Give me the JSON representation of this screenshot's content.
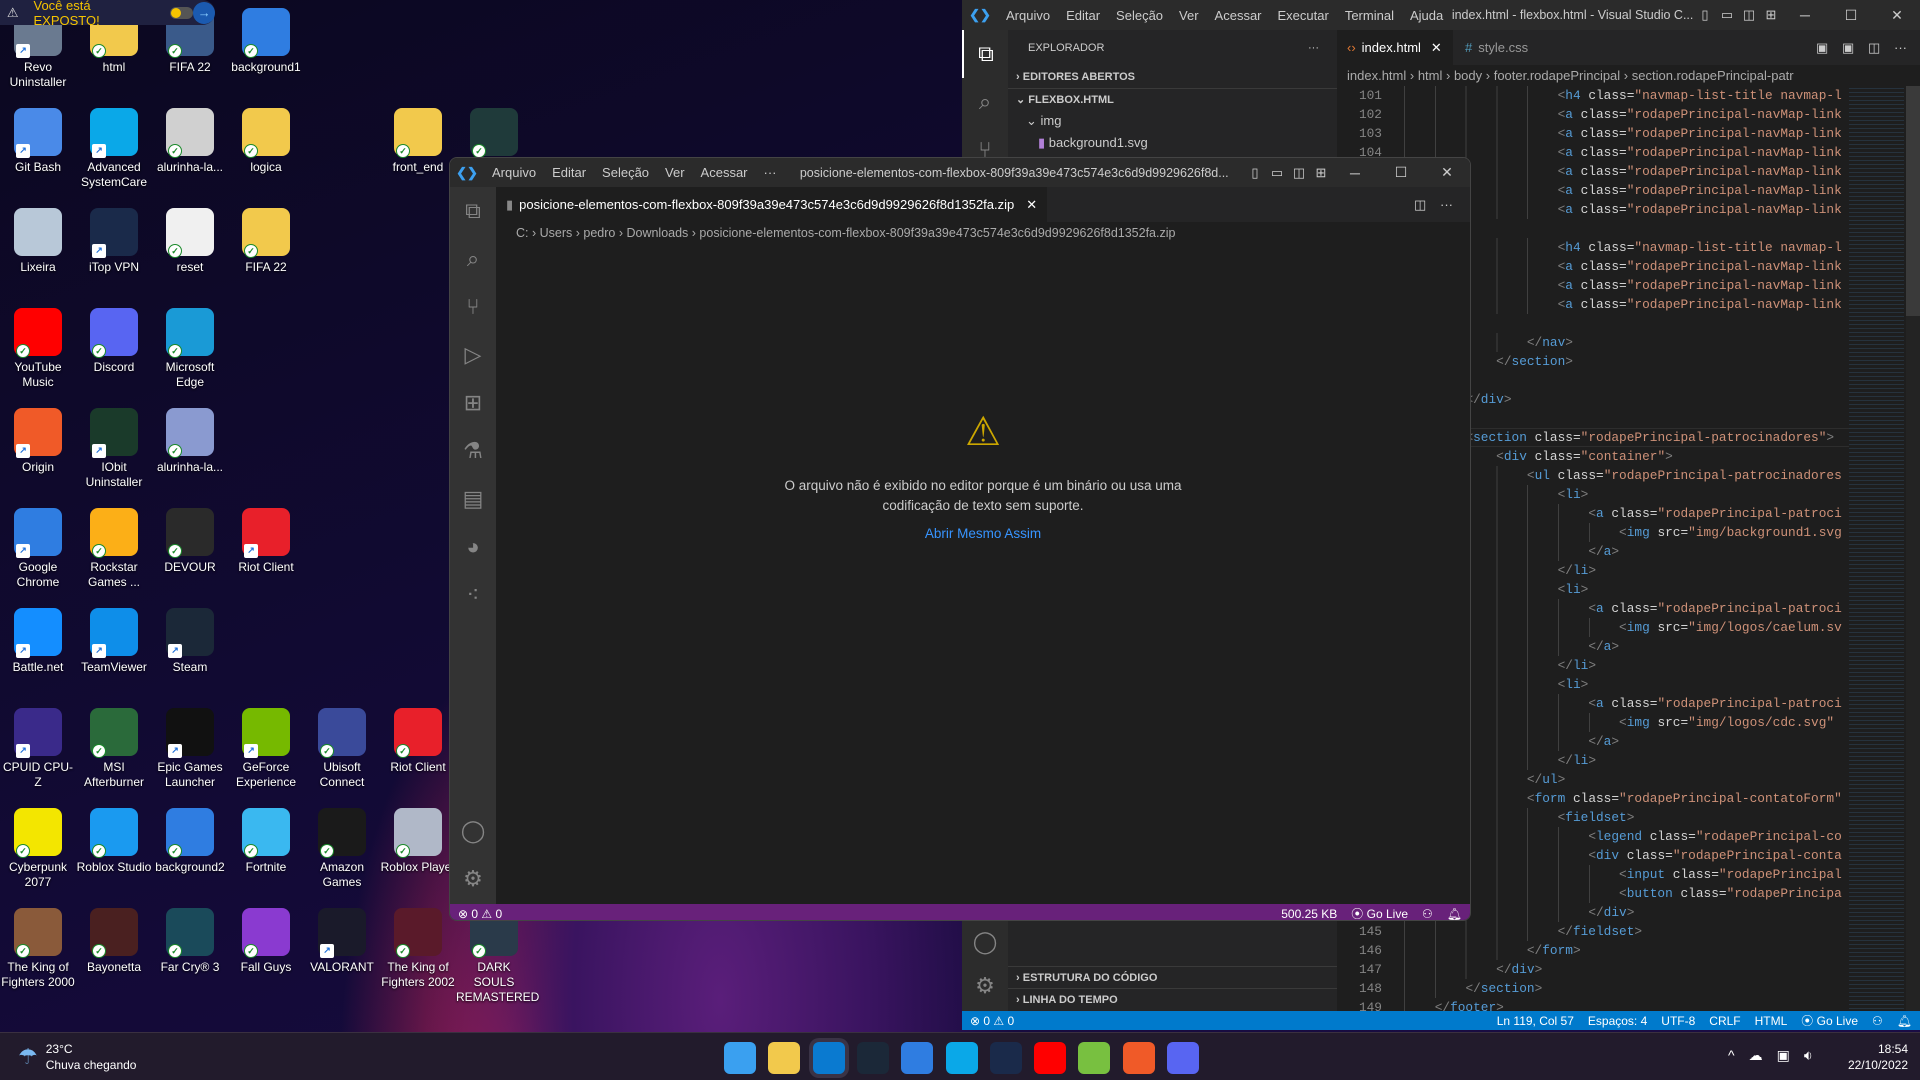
{
  "desktop": {
    "exposed_banner": {
      "text": "Você está EXPOSTO!",
      "color": "#f5c400"
    },
    "icon_rows": [
      [
        {
          "label": "Revo Uninstaller",
          "icon": "revo-uninstaller-icon",
          "color": "#6a7a90",
          "badge": "shortcut"
        },
        {
          "label": "html",
          "icon": "folder-icon",
          "color": "#f2c94c",
          "badge": "synced"
        },
        {
          "label": "FIFA 22",
          "icon": "fifa-icon",
          "color": "#3a5a8a",
          "badge": "synced"
        },
        {
          "label": "background1",
          "icon": "chrome-icon",
          "color": "#2f7de1",
          "badge": "synced"
        }
      ],
      [
        {
          "label": "Git Bash",
          "icon": "git-bash-icon",
          "color": "#4a8ae8",
          "badge": "shortcut"
        },
        {
          "label": "Advanced SystemCare",
          "icon": "advanced-systemcare-icon",
          "color": "#0aa8e8",
          "badge": "shortcut"
        },
        {
          "label": "alurinha-la...",
          "icon": "file-thumbnail-icon",
          "color": "#d0d0d0",
          "badge": "synced"
        },
        {
          "label": "logica",
          "icon": "folder-icon",
          "color": "#f2c94c",
          "badge": "synced"
        },
        null,
        {
          "label": "front_end",
          "icon": "folder-icon",
          "color": "#f2c94c",
          "badge": "synced"
        },
        {
          "label": "",
          "icon": "image-thumbnail-icon",
          "color": "#1f3a3a",
          "badge": "synced"
        }
      ],
      [
        {
          "label": "Lixeira",
          "icon": "recycle-bin-icon",
          "color": "#b8c8d8",
          "badge": ""
        },
        {
          "label": "iTop VPN",
          "icon": "itop-vpn-icon",
          "color": "#1a2a4a",
          "badge": "shortcut"
        },
        {
          "label": "reset",
          "icon": "vscode-file-icon",
          "color": "#f0f0f0",
          "badge": "synced"
        },
        {
          "label": "FIFA 22",
          "icon": "folder-icon",
          "color": "#f2c94c",
          "badge": "synced"
        }
      ],
      [
        {
          "label": "YouTube Music",
          "icon": "youtube-music-icon",
          "color": "#f00",
          "badge": "synced"
        },
        {
          "label": "Discord",
          "icon": "discord-icon",
          "color": "#5865f2",
          "badge": "synced"
        },
        {
          "label": "Microsoft Edge",
          "icon": "edge-icon",
          "color": "#1a9ad6",
          "badge": "synced"
        }
      ],
      [
        {
          "label": "Origin",
          "icon": "origin-icon",
          "color": "#f05a28",
          "badge": "shortcut"
        },
        {
          "label": "IObit Uninstaller",
          "icon": "iobit-uninstaller-icon",
          "color": "#1a3a2a",
          "badge": "shortcut"
        },
        {
          "label": "alurinha-la...",
          "icon": "file-thumbnail-icon",
          "color": "#8a9ad0",
          "badge": "synced"
        }
      ],
      [
        {
          "label": "Google Chrome",
          "icon": "chrome-icon",
          "color": "#2f7de1",
          "badge": "shortcut"
        },
        {
          "label": "Rockstar Games ...",
          "icon": "rockstar-icon",
          "color": "#fcaf17",
          "badge": "synced"
        },
        {
          "label": "DEVOUR",
          "icon": "devour-icon",
          "color": "#2a2a2a",
          "badge": "synced"
        },
        {
          "label": "Riot Client",
          "icon": "riot-client-icon",
          "color": "#e8202a",
          "badge": "shortcut"
        }
      ],
      [
        {
          "label": "Battle.net",
          "icon": "battlenet-icon",
          "color": "#148eff",
          "badge": "shortcut"
        },
        {
          "label": "TeamViewer",
          "icon": "teamviewer-icon",
          "color": "#0e8ee9",
          "badge": "shortcut"
        },
        {
          "label": "Steam",
          "icon": "steam-icon",
          "color": "#1b2838",
          "badge": "shortcut"
        }
      ],
      [
        {
          "label": "CPUID CPU-Z",
          "icon": "cpuz-icon",
          "color": "#3a2a8a",
          "badge": "shortcut"
        },
        {
          "label": "MSI Afterburner",
          "icon": "msi-afterburner-icon",
          "color": "#2a6a3a",
          "badge": "synced"
        },
        {
          "label": "Epic Games Launcher",
          "icon": "epic-games-icon",
          "color": "#111",
          "badge": "shortcut"
        },
        {
          "label": "GeForce Experience",
          "icon": "geforce-icon",
          "color": "#76b900",
          "badge": "shortcut"
        },
        {
          "label": "Ubisoft Connect",
          "icon": "ubisoft-icon",
          "color": "#3a4a9a",
          "badge": "synced"
        },
        {
          "label": "Riot Client",
          "icon": "riot-client-icon",
          "color": "#e8202a",
          "badge": "synced"
        }
      ],
      [
        {
          "label": "Cyberpunk 2077",
          "icon": "cyberpunk-icon",
          "color": "#f3e600",
          "badge": "synced"
        },
        {
          "label": "Roblox Studio",
          "icon": "roblox-studio-icon",
          "color": "#1a9af0",
          "badge": "synced"
        },
        {
          "label": "background2",
          "icon": "chrome-icon",
          "color": "#2f7de1",
          "badge": "synced"
        },
        {
          "label": "Fortnite",
          "icon": "fortnite-icon",
          "color": "#3ab8f0",
          "badge": "synced"
        },
        {
          "label": "Amazon Games",
          "icon": "amazon-games-icon",
          "color": "#1a1a1a",
          "badge": "synced"
        },
        {
          "label": "Roblox Player",
          "icon": "roblox-icon",
          "color": "#b0b8c8",
          "badge": "synced"
        }
      ],
      [
        {
          "label": "The King of Fighters 2000",
          "icon": "kof2000-icon",
          "color": "#8a5a3a",
          "badge": "synced"
        },
        {
          "label": "Bayonetta",
          "icon": "bayonetta-icon",
          "color": "#4a2020",
          "badge": "synced"
        },
        {
          "label": "Far Cry® 3",
          "icon": "farcry3-icon",
          "color": "#1a4a5a",
          "badge": "synced"
        },
        {
          "label": "Fall Guys",
          "icon": "fall-guys-icon",
          "color": "#8a3ad0",
          "badge": "synced"
        },
        {
          "label": "VALORANT",
          "icon": "valorant-icon",
          "color": "#1a1a2a",
          "badge": "shortcut"
        },
        {
          "label": "The King of Fighters 2002",
          "icon": "kof2002-icon",
          "color": "#5a1a2a",
          "badge": "synced"
        },
        {
          "label": "DARK SOULS REMASTERED",
          "icon": "dark-souls-icon",
          "color": "#2a3a4a",
          "badge": "synced"
        }
      ]
    ]
  },
  "back_window": {
    "menu": [
      "Arquivo",
      "Editar",
      "Seleção",
      "Ver",
      "Acessar",
      "Executar",
      "Terminal",
      "Ajuda"
    ],
    "title": "index.html - flexbox.html - Visual Studio C...",
    "explorer": {
      "header": "EXPLORADOR",
      "open_editors": "EDITORES ABERTOS",
      "folder": "FLEXBOX.HTML",
      "subfolder": "img",
      "file": "background1.svg",
      "outline": "ESTRUTURA DO CÓDIGO",
      "timeline": "LINHA DO TEMPO"
    },
    "tabs": [
      {
        "label": "index.html",
        "icon": "html-file-icon",
        "active": true
      },
      {
        "label": "style.css",
        "icon": "css-file-icon",
        "active": false
      }
    ],
    "breadcrumb": [
      "index.html",
      "html",
      "body",
      "footer.rodapePrincipal",
      "section.rodapePrincipal-patr"
    ],
    "first_line": 101,
    "current_line": 119,
    "code": [
      "                    <h4 class=\"navmap-list-title navmap-l",
      "                    <a class=\"rodapePrincipal-navMap-link",
      "                    <a class=\"rodapePrincipal-navMap-link",
      "                    <a class=\"rodapePrincipal-navMap-link",
      "                    <a class=\"rodapePrincipal-navMap-link",
      "                    <a class=\"rodapePrincipal-navMap-link",
      "                    <a class=\"rodapePrincipal-navMap-link",
      "",
      "                    <h4 class=\"navmap-list-title navmap-l",
      "                    <a class=\"rodapePrincipal-navMap-link",
      "                    <a class=\"rodapePrincipal-navMap-link",
      "                    <a class=\"rodapePrincipal-navMap-link",
      "",
      "                </nav>",
      "            </section>",
      "",
      "        </div>",
      "",
      "        <section class=\"rodapePrincipal-patrocinadores\">",
      "            <div class=\"container\">",
      "                <ul class=\"rodapePrincipal-patrocinadores",
      "                    <li>",
      "                        <a class=\"rodapePrincipal-patroci",
      "                            <img src=\"img/background1.svg",
      "                        </a>",
      "                    </li>",
      "                    <li>",
      "                        <a class=\"rodapePrincipal-patroci",
      "                            <img src=\"img/logos/caelum.sv",
      "                        </a>",
      "                    </li>",
      "                    <li>",
      "                        <a class=\"rodapePrincipal-patroci",
      "                            <img src=\"img/logos/cdc.svg\"",
      "                        </a>",
      "                    </li>",
      "                </ul>",
      "                <form class=\"rodapePrincipal-contatoForm\"",
      "                    <fieldset>",
      "                        <legend class=\"rodapePrincipal-co",
      "                        <div class=\"rodapePrincipal-conta",
      "                            <input class=\"rodapePrincipal",
      "                            <button class=\"rodapePrincipa",
      "                        </div>",
      "                    </fieldset>",
      "                </form>",
      "            </div>",
      "        </section>",
      "    </footer>"
    ],
    "status": {
      "errors": "0",
      "warnings": "0",
      "position": "Ln 119, Col 57",
      "spaces": "Espaços: 4",
      "encoding": "UTF-8",
      "eol": "CRLF",
      "language": "HTML",
      "golive": "Go Live",
      "color": "#007acc"
    }
  },
  "front_window": {
    "menu": [
      "Arquivo",
      "Editar",
      "Seleção",
      "Ver",
      "Acessar",
      "···"
    ],
    "title": "posicione-elementos-com-flexbox-809f39a39e473c574e3c6d9d9929626f8d...",
    "tab": "posicione-elementos-com-flexbox-809f39a39e473c574e3c6d9d9929626f8d1352fa.zip",
    "breadcrumb": [
      "C:",
      "Users",
      "pedro",
      "Downloads",
      "posicione-elementos-com-flexbox-809f39a39e473c574e3c6d9d9929626f8d1352fa.zip"
    ],
    "message_line1": "O arquivo não é exibido no editor porque é um binário ou usa uma",
    "message_line2": "codificação de texto sem suporte.",
    "open_anyway": "Abrir Mesmo Assim",
    "status": {
      "errors": "0",
      "warnings": "0",
      "size": "500.25 KB",
      "golive": "Go Live",
      "color": "#68217a"
    }
  },
  "taskbar": {
    "weather": {
      "temp": "23°C",
      "desc": "Chuva chegando"
    },
    "apps": [
      {
        "icon": "windows-start-icon",
        "color": "#3aa0f0"
      },
      {
        "icon": "file-explorer-icon",
        "color": "#f2c94c"
      },
      {
        "icon": "vscode-icon",
        "color": "#0a7ad0"
      },
      {
        "icon": "steam-icon",
        "color": "#1b2838"
      },
      {
        "icon": "chrome-icon",
        "color": "#2f7de1"
      },
      {
        "icon": "advanced-systemcare-icon",
        "color": "#0aa8e8"
      },
      {
        "icon": "itop-vpn-icon",
        "color": "#1a2a4a"
      },
      {
        "icon": "youtube-music-icon",
        "color": "#f00"
      },
      {
        "icon": "utorrent-icon",
        "color": "#78c040"
      },
      {
        "icon": "origin-icon",
        "color": "#f05a28"
      },
      {
        "icon": "discord-icon",
        "color": "#5865f2"
      }
    ],
    "time": "18:54",
    "date": "22/10/2022"
  }
}
